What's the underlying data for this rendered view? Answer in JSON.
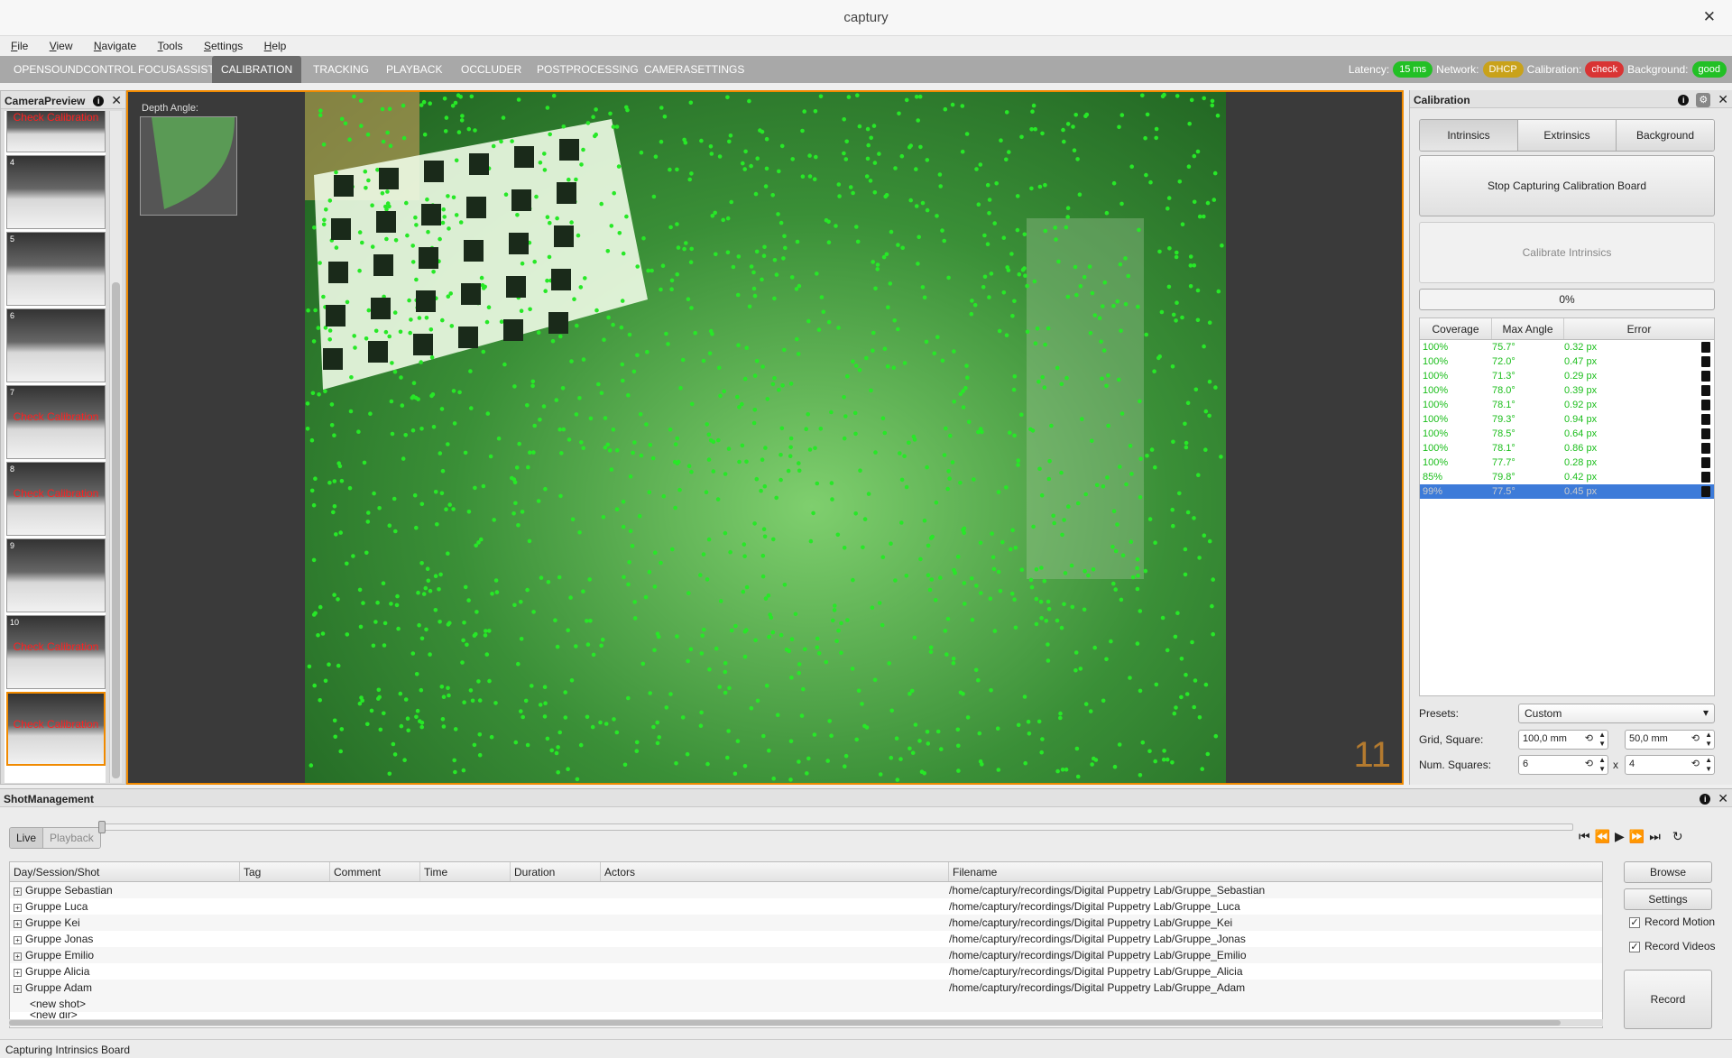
{
  "window": {
    "title": "captury"
  },
  "menu": [
    "File",
    "View",
    "Navigate",
    "Tools",
    "Settings",
    "Help"
  ],
  "tabs": [
    "OPENSOUNDCONTROL",
    "FOCUSASSIST",
    "CALIBRATION",
    "TRACKING",
    "PLAYBACK",
    "OCCLUDER",
    "POSTPROCESSING",
    "CAMERASETTINGS"
  ],
  "active_tab": "CALIBRATION",
  "status": {
    "latency_label": "Latency:",
    "latency_value": "15 ms",
    "network_label": "Network:",
    "network_value": "DHCP",
    "calibration_label": "Calibration:",
    "calibration_value": "check",
    "background_label": "Background:",
    "background_value": "good"
  },
  "camera_preview": {
    "title": "CameraPreview",
    "thumbs": [
      {
        "num": "",
        "warn": "Check Calibration"
      },
      {
        "num": "4",
        "warn": ""
      },
      {
        "num": "5",
        "warn": ""
      },
      {
        "num": "6",
        "warn": ""
      },
      {
        "num": "7",
        "warn": "Check Calibration"
      },
      {
        "num": "8",
        "warn": "Check Calibration"
      },
      {
        "num": "9",
        "warn": ""
      },
      {
        "num": "10",
        "warn": "Check Calibration"
      },
      {
        "num": "",
        "warn": "Check Calibration"
      }
    ]
  },
  "viewport": {
    "depth_label": "Depth Angle:",
    "camera_number": "11"
  },
  "calibration": {
    "title": "Calibration",
    "segments": [
      "Intrinsics",
      "Extrinsics",
      "Background"
    ],
    "stop_button": "Stop Capturing Calibration Board",
    "calibrate_button": "Calibrate Intrinsics",
    "progress": "0%",
    "columns": [
      "Coverage",
      "Max Angle",
      "Error"
    ],
    "rows": [
      [
        "100%",
        "75.7°",
        "0.32 px"
      ],
      [
        "100%",
        "72.0°",
        "0.47 px"
      ],
      [
        "100%",
        "71.3°",
        "0.29 px"
      ],
      [
        "100%",
        "78.0°",
        "0.39 px"
      ],
      [
        "100%",
        "78.1°",
        "0.92 px"
      ],
      [
        "100%",
        "79.3°",
        "0.94 px"
      ],
      [
        "100%",
        "78.5°",
        "0.64 px"
      ],
      [
        "100%",
        "78.1°",
        "0.86 px"
      ],
      [
        "100%",
        "77.7°",
        "0.28 px"
      ],
      [
        "85%",
        "79.8°",
        "0.42 px"
      ],
      [
        "99%",
        "77.5°",
        "0.45 px"
      ]
    ],
    "presets_label": "Presets:",
    "presets_value": "Custom",
    "grid_label": "Grid, Square:",
    "grid_a": "100,0 mm",
    "grid_b": "50,0 mm",
    "num_label": "Num. Squares:",
    "num_a": "6",
    "num_b": "4",
    "num_x": "x"
  },
  "shots": {
    "title": "ShotManagement",
    "live": "Live",
    "playback": "Playback",
    "columns": [
      "Day/Session/Shot",
      "Tag",
      "Comment",
      "Time",
      "Duration",
      "Actors",
      "Filename"
    ],
    "rows": [
      [
        "Gruppe Sebastian",
        "/home/captury/recordings/Digital Puppetry Lab/Gruppe_Sebastian"
      ],
      [
        "Gruppe Luca",
        "/home/captury/recordings/Digital Puppetry Lab/Gruppe_Luca"
      ],
      [
        "Gruppe Kei",
        "/home/captury/recordings/Digital Puppetry Lab/Gruppe_Kei"
      ],
      [
        "Gruppe Jonas",
        "/home/captury/recordings/Digital Puppetry Lab/Gruppe_Jonas"
      ],
      [
        "Gruppe Emilio",
        "/home/captury/recordings/Digital Puppetry Lab/Gruppe_Emilio"
      ],
      [
        "Gruppe Alicia",
        "/home/captury/recordings/Digital Puppetry Lab/Gruppe_Alicia"
      ],
      [
        "Gruppe Adam",
        "/home/captury/recordings/Digital Puppetry Lab/Gruppe_Adam"
      ]
    ],
    "new_shot": "<new shot>",
    "new_dir": "<new dir>",
    "browse": "Browse",
    "settings": "Settings",
    "record_motion": "Record Motion",
    "record_videos": "Record Videos",
    "record": "Record"
  },
  "statusbar": "Capturing Intrinsics Board"
}
